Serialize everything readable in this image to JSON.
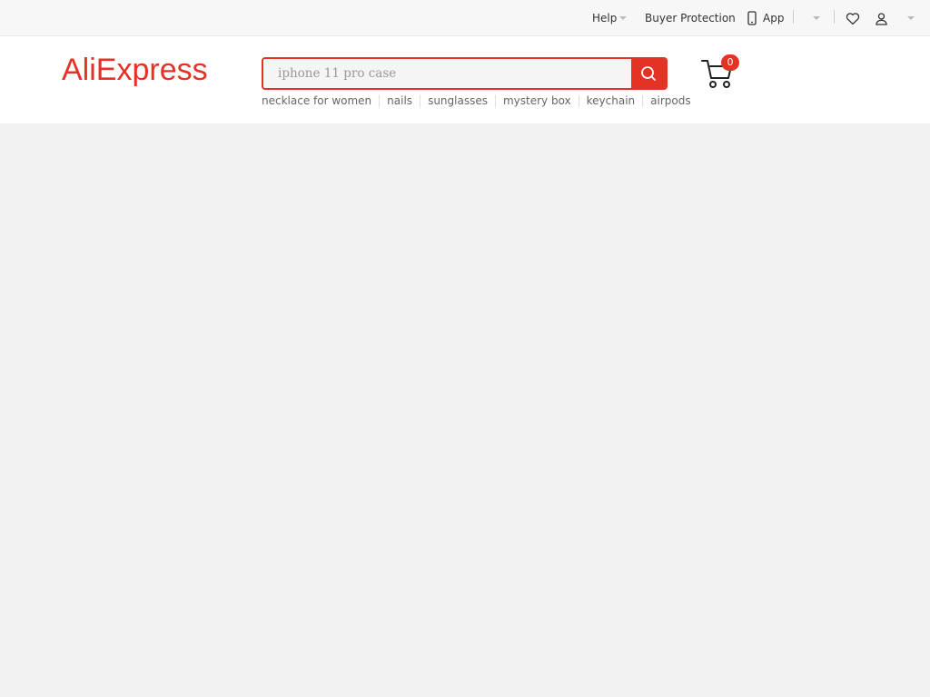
{
  "topbar": {
    "help_label": "Help",
    "buyer_protection_label": "Buyer Protection",
    "app_label": "App",
    "icons": [
      "phone-icon",
      "chevron-down-icon",
      "heart-icon",
      "user-icon"
    ]
  },
  "header": {
    "logo_text": "AliExpress",
    "search": {
      "placeholder": "iphone 11 pro case",
      "value": ""
    },
    "hot_searches": [
      "necklace for women",
      "nails",
      "sunglasses",
      "mystery box",
      "keychain",
      "airpods"
    ],
    "cart_count": "0"
  },
  "colors": {
    "brand": "#e43225",
    "page_background": "#f2f2f2",
    "topbar_background": "#f7f7f7"
  }
}
